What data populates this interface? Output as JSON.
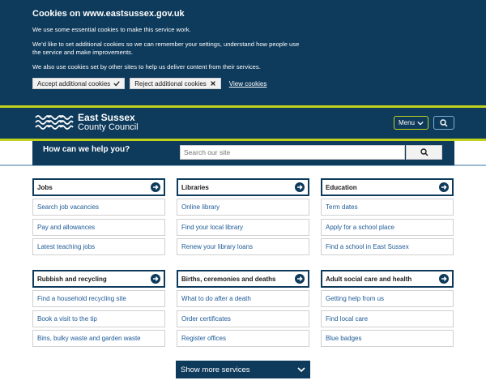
{
  "cookie": {
    "title": "Cookies on www.eastsussex.gov.uk",
    "p1": "We use some essential cookies to make this service work.",
    "p2": "We'd like to set additional cookies so we can remember your settings, understand how people use the service and make improvements.",
    "p3": "We also use cookies set by other sites to help us deliver content from their services.",
    "accept": "Accept additional cookies",
    "reject": "Reject additional cookies",
    "view": "View cookies"
  },
  "header": {
    "logo_line1": "East Sussex",
    "logo_line2": "County Council",
    "menu_label": "Menu"
  },
  "help": {
    "title": "How can we help you?",
    "search_placeholder": "Search our site"
  },
  "services": [
    {
      "title": "Jobs",
      "links": [
        "Search job vacancies",
        "Pay and allowances",
        "Latest teaching jobs"
      ]
    },
    {
      "title": "Libraries",
      "links": [
        "Online library",
        "Find your local library",
        "Renew your library loans"
      ]
    },
    {
      "title": "Education",
      "links": [
        "Term dates",
        "Apply for a school place",
        "Find a school in East Sussex"
      ]
    },
    {
      "title": "Rubbish and recycling",
      "links": [
        "Find a household recycling site",
        "Book a visit to the tip",
        "Bins, bulky waste and garden waste"
      ]
    },
    {
      "title": "Births, ceremonies and deaths",
      "links": [
        "What to do after a death",
        "Order certificates",
        "Register offices"
      ]
    },
    {
      "title": "Adult social care and health",
      "links": [
        "Getting help from us",
        "Find local care",
        "Blue badges"
      ]
    }
  ],
  "more_label": "Show more services",
  "colors": {
    "brand": "#0e3a5b",
    "accent": "#c0d21d",
    "link": "#1d5a96"
  }
}
